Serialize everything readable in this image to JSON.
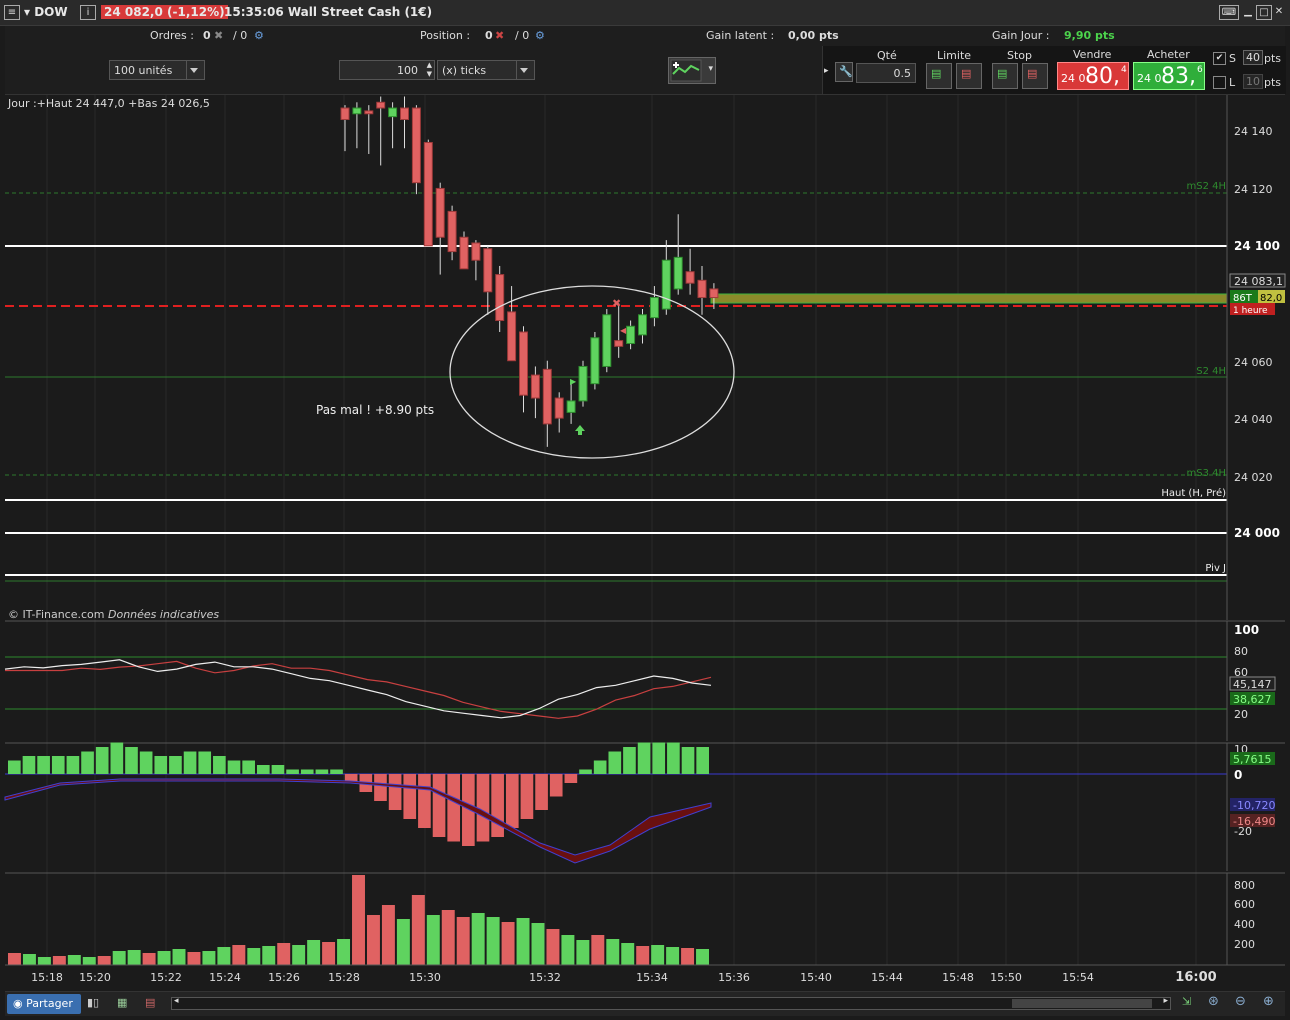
{
  "titlebar": {
    "symbol": "DOW",
    "change": "24 082,0 (-1,12%)",
    "time_instrument": "15:35:06 Wall Street Cash (1€)"
  },
  "infobar": {
    "orders_label": "Ordres :",
    "orders_val1": "0",
    "orders_val2": "/ 0",
    "position_label": "Position :",
    "position_val1": "0",
    "position_val2": "/ 0",
    "gain_latent_label": "Gain latent :",
    "gain_latent_val": "0,00 pts",
    "gain_jour_label": "Gain Jour :",
    "gain_jour_val": "9,90 pts"
  },
  "toolbar": {
    "units_select": "100 unités",
    "ticks_value": "100",
    "ticks_unit": "(x) ticks",
    "qty_label": "Qté",
    "qty_value": "0.5",
    "limit_label": "Limite",
    "stop_label": "Stop",
    "sell_label": "Vendre",
    "sell_small": "24 0",
    "sell_big": "80,",
    "sell_exp": "4",
    "buy_label": "Acheter",
    "buy_small": "24 0",
    "buy_big": "83,",
    "buy_exp": "6",
    "s_label": "S",
    "s_value": "40",
    "s_unit": "pts",
    "l_label": "L",
    "l_value": "10",
    "l_unit": "pts"
  },
  "colors": {
    "up": "#5fd35f",
    "down": "#e06262",
    "accent_red": "#d83a3a",
    "accent_green": "#2fae3a",
    "bg": "#1b1b1b"
  },
  "chart": {
    "header": "Jour :+Haut 24 447,0 +Bas 24 026,5",
    "copyright": "© IT-Finance.com",
    "copyright_note": "Données indicatives",
    "annotation": "Pas mal ! +8.90 pts",
    "price_ticks": [
      "24 140",
      "24 120",
      "24 100",
      "24 083,1",
      "24 060",
      "24 040",
      "24 020",
      "24 000"
    ],
    "price_tag_left": "86T",
    "price_tag_right": "82,0",
    "price_tag_sub": "1 heure",
    "level_labels": {
      "m52": "mS2 4H",
      "s2": "S2 4H",
      "m53": "mS3 4H",
      "haut": "Haut (H, Pré)",
      "piv": "Piv J"
    },
    "time_ticks": [
      "15:18",
      "15:20",
      "15:22",
      "15:24",
      "15:26",
      "15:28",
      "15:30",
      "15:32",
      "15:34",
      "15:36",
      "15:40",
      "15:44",
      "15:48",
      "15:50",
      "15:54",
      "16:00"
    ]
  },
  "osc1": {
    "ticks": [
      "100",
      "80",
      "60",
      "20"
    ],
    "val1": "45,147",
    "val2": "38,627"
  },
  "osc2": {
    "ticks": [
      "10",
      "0",
      "-20"
    ],
    "val1": "5,7615",
    "val2": "-10,720",
    "val3": "-16,490"
  },
  "volume": {
    "ticks": [
      "800",
      "600",
      "400",
      "200"
    ]
  },
  "bottombar": {
    "share_label": "Partager"
  },
  "chart_data": {
    "type": "candlestick",
    "candles": [
      {
        "o": 24148,
        "h": 24149,
        "l": 24133,
        "c": 24144
      },
      {
        "o": 24146,
        "h": 24150,
        "l": 24134,
        "c": 24148
      },
      {
        "o": 24147,
        "h": 24149,
        "l": 24132,
        "c": 24146
      },
      {
        "o": 24150,
        "h": 24152,
        "l": 24128,
        "c": 24148
      },
      {
        "o": 24145,
        "h": 24150,
        "l": 24134,
        "c": 24148
      },
      {
        "o": 24148,
        "h": 24152,
        "l": 24134,
        "c": 24144
      },
      {
        "o": 24148,
        "h": 24149,
        "l": 24118,
        "c": 24122
      },
      {
        "o": 24136,
        "h": 24137,
        "l": 24100,
        "c": 24100
      },
      {
        "o": 24120,
        "h": 24122,
        "l": 24090,
        "c": 24103
      },
      {
        "o": 24112,
        "h": 24114,
        "l": 24095,
        "c": 24098
      },
      {
        "o": 24103,
        "h": 24105,
        "l": 24093,
        "c": 24092
      },
      {
        "o": 24101,
        "h": 24102,
        "l": 24088,
        "c": 24095
      },
      {
        "o": 24099,
        "h": 24100,
        "l": 24076,
        "c": 24084
      },
      {
        "o": 24090,
        "h": 24093,
        "l": 24070,
        "c": 24074
      },
      {
        "o": 24077,
        "h": 24086,
        "l": 24060,
        "c": 24060
      },
      {
        "o": 24070,
        "h": 24072,
        "l": 24042,
        "c": 24048
      },
      {
        "o": 24055,
        "h": 24058,
        "l": 24040,
        "c": 24047
      },
      {
        "o": 24057,
        "h": 24060,
        "l": 24030,
        "c": 24038
      },
      {
        "o": 24047,
        "h": 24049,
        "l": 24035,
        "c": 24040
      },
      {
        "o": 24042,
        "h": 24052,
        "l": 24038,
        "c": 24046
      },
      {
        "o": 24046,
        "h": 24060,
        "l": 24044,
        "c": 24058
      },
      {
        "o": 24052,
        "h": 24070,
        "l": 24050,
        "c": 24068
      },
      {
        "o": 24058,
        "h": 24078,
        "l": 24056,
        "c": 24076
      },
      {
        "o": 24067,
        "h": 24080,
        "l": 24061,
        "c": 24065
      },
      {
        "o": 24066,
        "h": 24074,
        "l": 24064,
        "c": 24072
      },
      {
        "o": 24069,
        "h": 24078,
        "l": 24066,
        "c": 24076
      },
      {
        "o": 24075,
        "h": 24086,
        "l": 24072,
        "c": 24082
      },
      {
        "o": 24078,
        "h": 24102,
        "l": 24076,
        "c": 24095
      },
      {
        "o": 24085,
        "h": 24111,
        "l": 24083,
        "c": 24096
      },
      {
        "o": 24091,
        "h": 24099,
        "l": 24083,
        "c": 24087
      },
      {
        "o": 24088,
        "h": 24093,
        "l": 24076,
        "c": 24082
      },
      {
        "o": 24085,
        "h": 24087,
        "l": 24078,
        "c": 24082
      }
    ],
    "oscillator": [
      62,
      64,
      63,
      65,
      66,
      68,
      70,
      64,
      60,
      62,
      66,
      68,
      64,
      64,
      62,
      58,
      54,
      52,
      48,
      44,
      40,
      34,
      30,
      26,
      24,
      22,
      20,
      22,
      28,
      36,
      40,
      46,
      48,
      52,
      56,
      54,
      50,
      48
    ],
    "macd_hist": [
      3,
      4,
      4,
      4,
      4,
      5,
      6,
      7,
      6,
      5,
      4,
      4,
      5,
      5,
      4,
      3,
      3,
      2,
      2,
      1,
      1,
      1,
      1,
      -2,
      -4,
      -6,
      -8,
      -10,
      -12,
      -14,
      -15,
      -16,
      -15,
      -14,
      -12,
      -10,
      -8,
      -5,
      -2,
      1,
      3,
      5,
      6,
      7,
      7,
      7,
      6,
      6
    ],
    "volume": [
      120,
      110,
      80,
      90,
      100,
      80,
      90,
      140,
      150,
      120,
      140,
      160,
      130,
      140,
      180,
      200,
      170,
      190,
      220,
      200,
      250,
      230,
      260,
      900,
      500,
      600,
      460,
      700,
      500,
      550,
      480,
      520,
      480,
      430,
      470,
      420,
      360,
      300,
      250,
      300,
      260,
      220,
      190,
      200,
      180,
      170,
      160
    ],
    "levels": {
      "resistance_white": 24100,
      "dash_red": 24079,
      "price_green": 24082
    }
  }
}
